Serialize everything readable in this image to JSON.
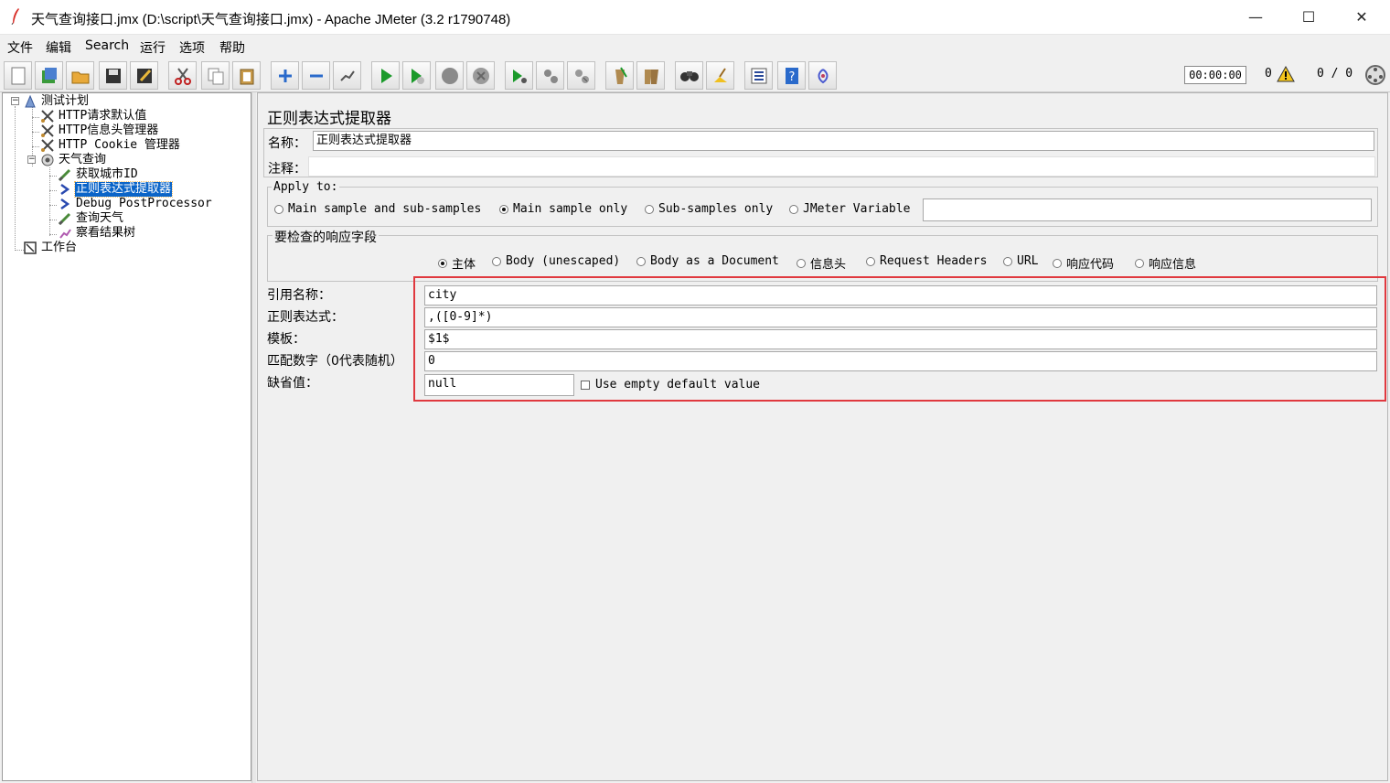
{
  "window": {
    "title": "天气查询接口.jmx (D:\\script\\天气查询接口.jmx) - Apache JMeter (3.2 r1790748)",
    "minimize": "—",
    "maximize": "☐",
    "close": "✕"
  },
  "menu": [
    "文件",
    "编辑",
    "Search",
    "运行",
    "选项",
    "帮助"
  ],
  "toolbar": {
    "buttons": [
      "new-icon",
      "templates-icon",
      "open-icon",
      "save-icon",
      "save-as-icon",
      "cut-icon",
      "copy-icon",
      "paste-icon",
      "expand-icon",
      "collapse-icon",
      "toggle-icon",
      "start-icon",
      "start-no-pause-icon",
      "stop-icon",
      "shutdown-icon",
      "remote-start-icon",
      "remote-stop-icon",
      "remote-shutdown-icon",
      "clear-icon",
      "clear-all-icon",
      "search-icon",
      "reset-search-icon",
      "function-helper-icon",
      "help-icon",
      "log-viewer-icon"
    ],
    "timer": "00:00:00",
    "error_count": "0",
    "thread_count": "0 / 0"
  },
  "tree": {
    "items": [
      {
        "label": "测试计划",
        "icon": "test-plan-icon"
      },
      {
        "label": "HTTP请求默认值",
        "icon": "config-element-icon"
      },
      {
        "label": "HTTP信息头管理器",
        "icon": "config-element-icon"
      },
      {
        "label": "HTTP Cookie 管理器",
        "icon": "config-element-icon"
      },
      {
        "label": "天气查询",
        "icon": "thread-group-icon"
      },
      {
        "label": "获取城市ID",
        "icon": "sampler-icon"
      },
      {
        "label": "正则表达式提取器",
        "icon": "post-processor-icon"
      },
      {
        "label": "Debug PostProcessor",
        "icon": "post-processor-icon"
      },
      {
        "label": "查询天气",
        "icon": "sampler-icon"
      },
      {
        "label": "察看结果树",
        "icon": "listener-icon"
      },
      {
        "label": "工作台",
        "icon": "workbench-icon"
      }
    ],
    "selected": "正则表达式提取器"
  },
  "panel": {
    "title": "正则表达式提取器",
    "name_label": "名称：",
    "name_value": "正则表达式提取器",
    "comment_label": "注释：",
    "comment_value": "",
    "apply_to": {
      "title": "Apply to:",
      "options": [
        "Main sample and sub-samples",
        "Main sample only",
        "Sub-samples only",
        "JMeter Variable"
      ],
      "selected": "Main sample only",
      "variable_value": ""
    },
    "field_to_check": {
      "title": "要检查的响应字段",
      "options": [
        "主体",
        "Body (unescaped)",
        "Body as a Document",
        "信息头",
        "Request Headers",
        "URL",
        "响应代码",
        "响应信息"
      ],
      "selected": "主体"
    },
    "ref_name_label": "引用名称：",
    "ref_name_value": "city",
    "regex_label": "正则表达式：",
    "regex_value": ",([0-9]*)",
    "template_label": "模板：",
    "template_value": "$1$",
    "match_no_label": "匹配数字（0代表随机）",
    "match_no_value": "0",
    "default_label": "缺省值：",
    "default_value": "null",
    "use_empty_default_label": "Use empty default value",
    "use_empty_default_checked": false
  },
  "colors": {
    "selection": "#0a64c8",
    "highlight_box": "#e0393f"
  }
}
